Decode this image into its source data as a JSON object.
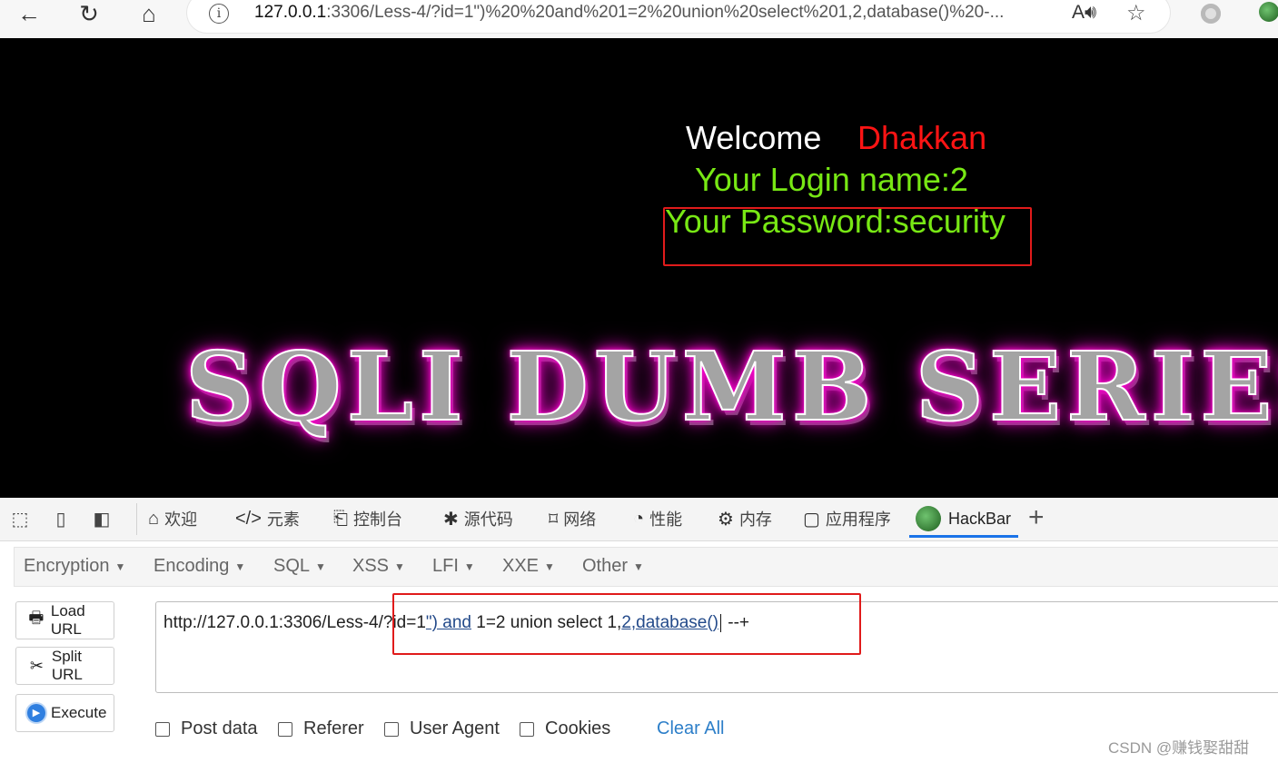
{
  "browser": {
    "url_host": "127.0.0.1",
    "url_rest": ":3306/Less-4/?id=1\")%20%20and%201=2%20union%20select%201,2,database()%20-...",
    "icons": [
      "back-arrow-icon",
      "reload-icon",
      "home-icon",
      "info-icon",
      "read-aloud-icon",
      "favorite-star-icon"
    ]
  },
  "page": {
    "welcome": "Welcome",
    "welcome_name": "Dhakkan",
    "login_line": "Your Login name:2",
    "password_line": "Your Password:security",
    "banner": "SQLI DUMB SERIES",
    "colors": {
      "welcome": "#ffffff",
      "name": "#ff1414",
      "result": "#78e814",
      "highlight": "#e01b1b",
      "glow": "#ff00d0"
    }
  },
  "devtools": {
    "tabs": [
      {
        "label": "欢迎",
        "icon": "home-icon"
      },
      {
        "label": "元素",
        "icon": "code-icon"
      },
      {
        "label": "控制台",
        "icon": "console-icon"
      },
      {
        "label": "源代码",
        "icon": "bug-icon"
      },
      {
        "label": "网络",
        "icon": "wifi-icon"
      },
      {
        "label": "性能",
        "icon": "gauge-icon"
      },
      {
        "label": "内存",
        "icon": "chip-icon"
      },
      {
        "label": "应用程序",
        "icon": "app-icon"
      },
      {
        "label": "HackBar",
        "icon": "hackbar-logo-icon"
      }
    ],
    "active_tab": "HackBar",
    "accent": "#1a73e8"
  },
  "hackbar": {
    "menu": [
      "Encryption",
      "Encoding",
      "SQL",
      "XSS",
      "LFI",
      "XXE",
      "Other"
    ],
    "buttons": {
      "load": "Load URL",
      "split": "Split URL",
      "execute": "Execute"
    },
    "url": {
      "part1": "http://127.0.0.1:3306/Less-4/?id=1",
      "part2": "\")  and",
      "part3": " 1=2 union select 1,",
      "part4": "2,database()",
      "part5": " --+"
    },
    "checkboxes": [
      "Post data",
      "Referer",
      "User Agent",
      "Cookies"
    ],
    "clear_all": "Clear All"
  },
  "watermark": "CSDN @赚钱娶甜甜"
}
